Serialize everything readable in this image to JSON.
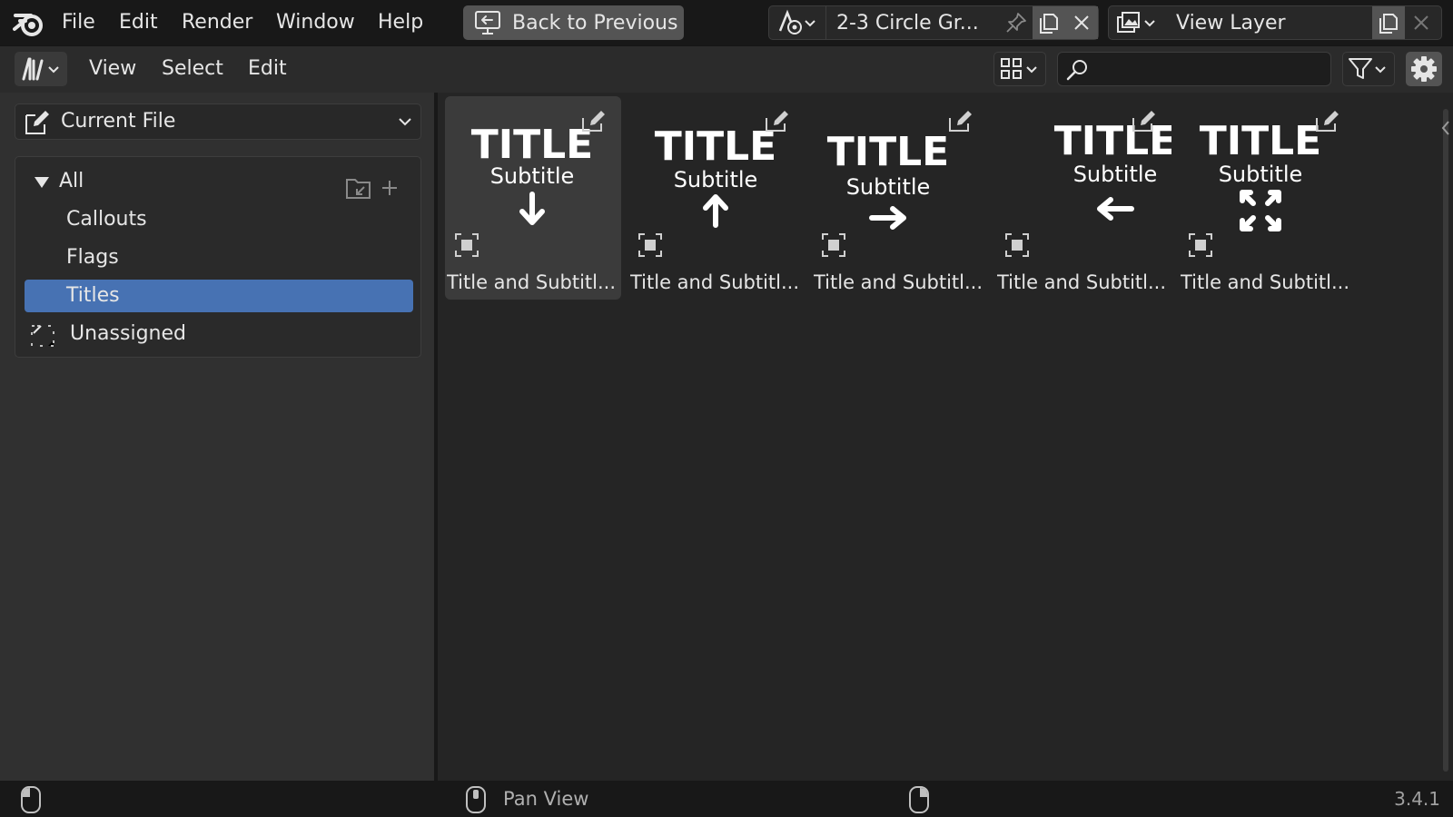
{
  "topbar": {
    "menus": [
      "File",
      "Edit",
      "Render",
      "Window",
      "Help"
    ],
    "back_label": "Back to Previous",
    "scene_name": "2-3 Circle Gr...",
    "view_layer": "View Layer"
  },
  "header": {
    "menus": [
      "View",
      "Select",
      "Edit"
    ],
    "search": {
      "value": "",
      "placeholder": ""
    }
  },
  "sidebar": {
    "library": "Current File",
    "categories": [
      {
        "label": "All"
      },
      {
        "label": "Callouts"
      },
      {
        "label": "Flags"
      },
      {
        "label": "Titles",
        "active": true
      },
      {
        "label": "Unassigned"
      }
    ]
  },
  "assets": [
    {
      "title": "TITLE",
      "subtitle": "Subtitle",
      "arrow": "down",
      "name": "Title and Subtitl...",
      "selected": true
    },
    {
      "title": "TITLE",
      "subtitle": "Subtitle",
      "arrow": "up",
      "name": "Title and Subtitl..."
    },
    {
      "title": "TITLE",
      "subtitle": "Subtitle",
      "arrow": "right",
      "name": "Title and Subtitl..."
    },
    {
      "title": "TITLE",
      "subtitle": "Subtitle",
      "arrow": "left",
      "name": "Title and Subtitl..."
    },
    {
      "title": "TITLE",
      "subtitle": "Subtitle",
      "arrow": "expand",
      "name": "Title and Subtitl..."
    }
  ],
  "status": {
    "middle_label": "Pan View",
    "version": "3.4.1"
  },
  "colors": {
    "accent": "#4772b3",
    "button": "#545454",
    "panel": "#303030",
    "asset_area": "#252525"
  }
}
